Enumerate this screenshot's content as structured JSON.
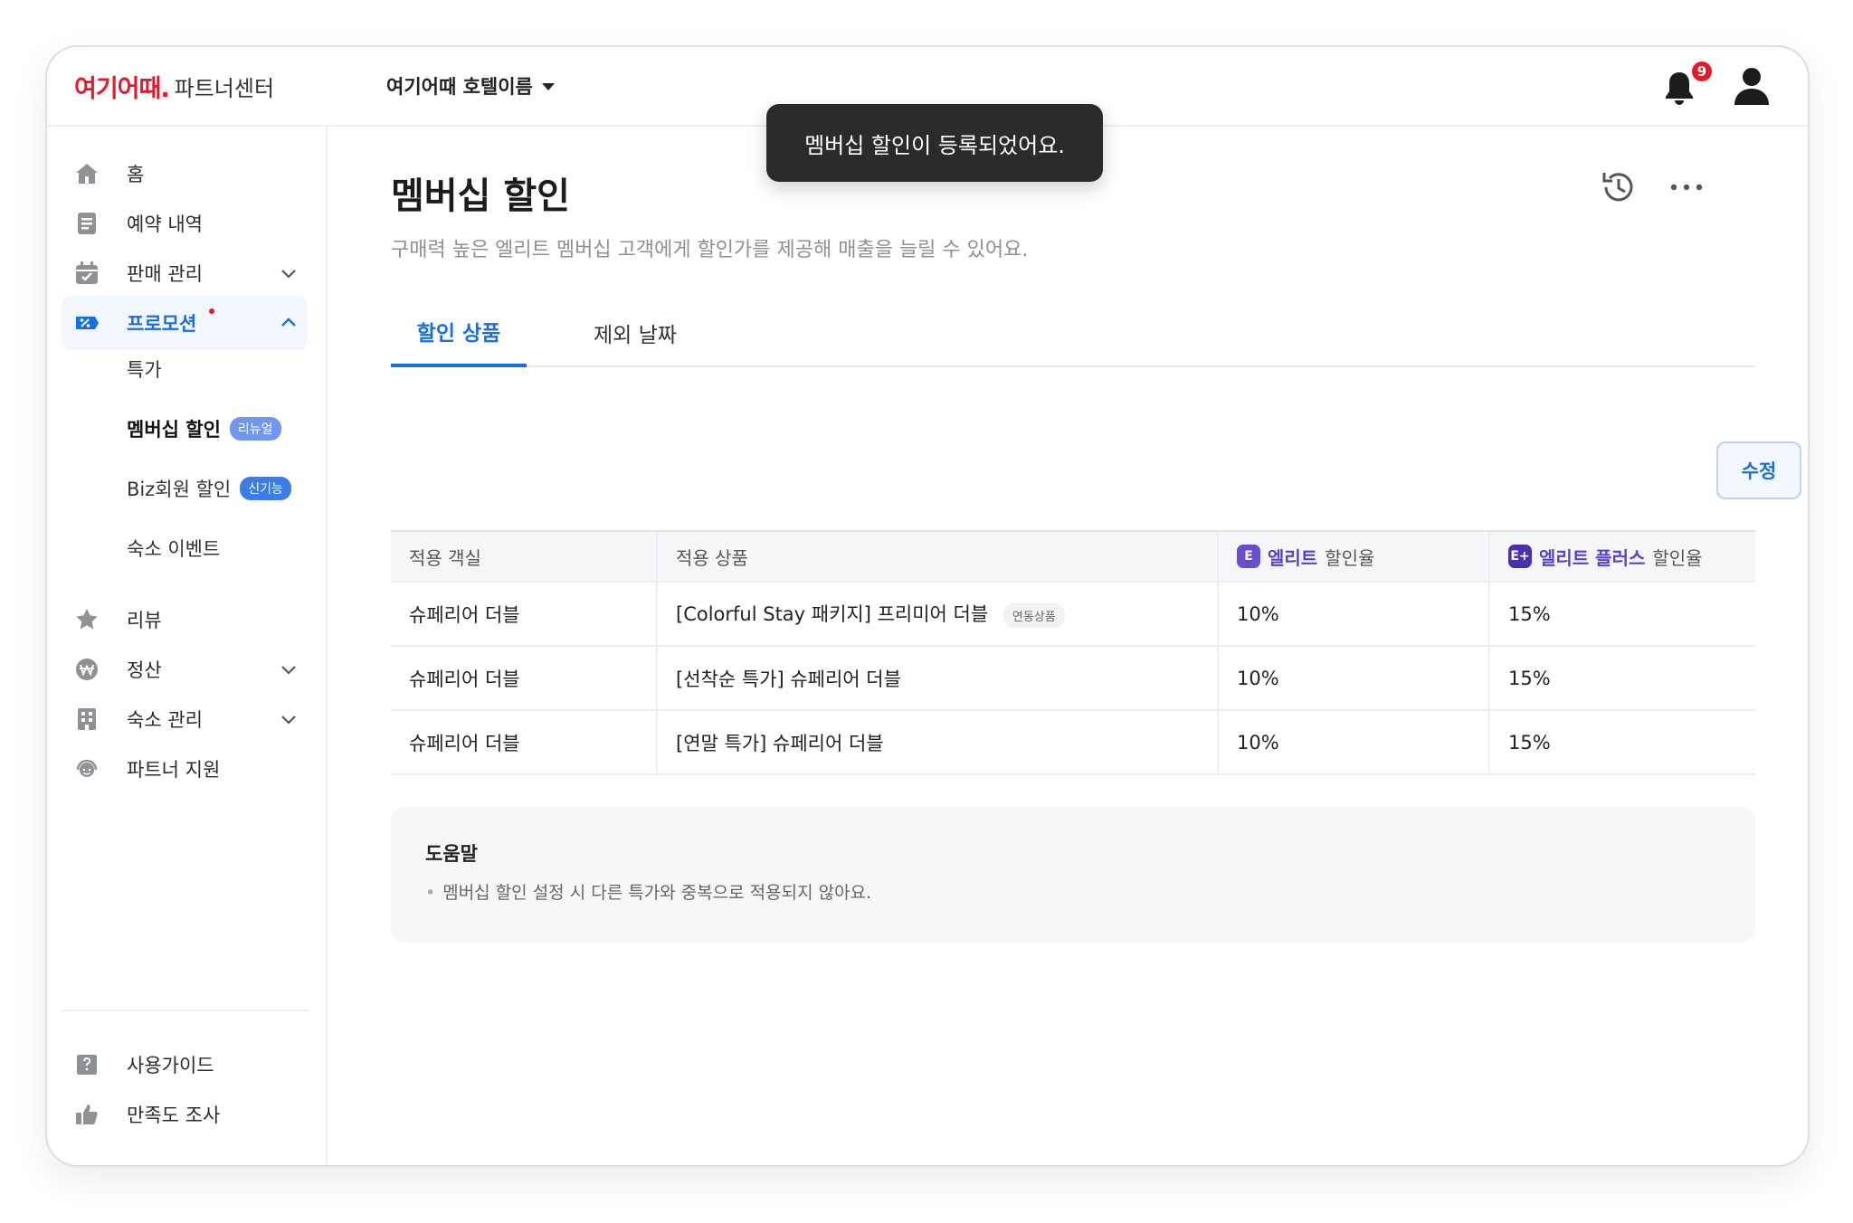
{
  "header": {
    "logo_mark": "여기어때.",
    "logo_sub": "파트너센터",
    "hotel_name": "여기어때 호텔이름",
    "notification_count": "9"
  },
  "toast": {
    "message": "멤버십 할인이 등록되었어요."
  },
  "sidebar": {
    "items": [
      {
        "label": "홈",
        "icon": "home-icon"
      },
      {
        "label": "예약 내역",
        "icon": "document-icon"
      },
      {
        "label": "판매 관리",
        "icon": "calendar-icon"
      },
      {
        "label": "프로모션",
        "icon": "percent-tag-icon"
      },
      {
        "label": "리뷰",
        "icon": "star-icon"
      },
      {
        "label": "정산",
        "icon": "won-coin-icon"
      },
      {
        "label": "숙소 관리",
        "icon": "building-icon"
      },
      {
        "label": "파트너 지원",
        "icon": "headset-icon"
      },
      {
        "label": "사용가이드",
        "icon": "guide-book-icon"
      },
      {
        "label": "만족도 조사",
        "icon": "thumbs-up-icon"
      }
    ],
    "promo_sub": [
      {
        "label": "특가"
      },
      {
        "label": "멤버십 할인",
        "badge": "리뉴얼"
      },
      {
        "label": "Biz회원 할인",
        "badge": "신기능"
      },
      {
        "label": "숙소 이벤트"
      }
    ]
  },
  "main": {
    "title": "멤버십 할인",
    "subtitle": "구매력 높은 엘리트 멤버십 고객에게 할인가를 제공해 매출을 늘릴 수 있어요.",
    "tabs": [
      {
        "label": "할인 상품"
      },
      {
        "label": "제외 날짜"
      }
    ],
    "edit_label": "수정",
    "table": {
      "headers": {
        "room": "적용 객실",
        "product": "적용 상품",
        "elite_icon": "E",
        "elite_name": "엘리트",
        "elite_suffix": "할인율",
        "elite_plus_icon": "E+",
        "elite_plus_name": "엘리트 플러스",
        "elite_plus_suffix": "할인율"
      },
      "rows": [
        {
          "room": "슈페리어 더블",
          "product": "[Colorful Stay 패키지] 프리미어 더블",
          "tag": "연동상품",
          "elite": "10%",
          "elite_plus": "15%"
        },
        {
          "room": "슈페리어 더블",
          "product": "[선착순 특가] 슈페리어 더블",
          "elite": "10%",
          "elite_plus": "15%"
        },
        {
          "room": "슈페리어 더블",
          "product": "[연말 특가] 슈페리어 더블",
          "elite": "10%",
          "elite_plus": "15%"
        }
      ]
    },
    "help": {
      "title": "도움말",
      "items": [
        "멤버십 할인 설정 시 다른 특가와 중복으로 적용되지 않아요."
      ]
    }
  },
  "colors": {
    "brand_red": "#e6192b",
    "accent_blue": "#1a6fe0",
    "elite_purple": "#5b3fd0",
    "toast_bg": "#2b2b2e"
  }
}
